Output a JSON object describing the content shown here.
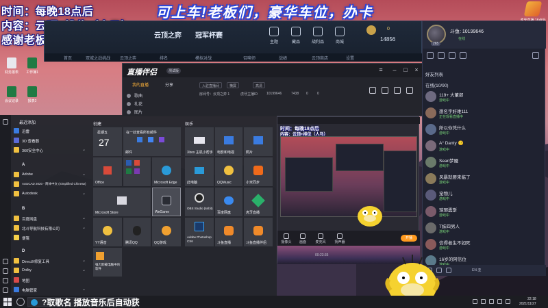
{
  "overlay": {
    "line1": "时间：每晚18点后",
    "line2": "内容：云顶+排位（人马）",
    "line3": "感谢老板们的关注与礼物！",
    "banner": "可上车!老板们，豪华车位，办卡",
    "logo_text": "虎牙直播 18点后"
  },
  "desktop_icons": [
    "回收站",
    "腾讯视频",
    "LOL",
    "WeGame",
    "财务报表",
    "工作簿1",
    "会议记录",
    "报表2"
  ],
  "game": {
    "tab_main": "云顶之弈",
    "tab_cup": "冠军杯赛",
    "nav": [
      "主题",
      "藏品",
      "战利品",
      "商城"
    ],
    "gold": "0",
    "currency": "14856",
    "sub_tabs": [
      "首页",
      "双城之战挑战",
      "云顶之弈",
      "排名",
      "模拟对战",
      "召唤师",
      "战绩",
      "云顶商店",
      "设置"
    ]
  },
  "assistant": {
    "logo": "直播伴侣",
    "badge": "测试版",
    "tabs": [
      "我的直播",
      "分享"
    ],
    "category_label": "热门直播",
    "sources": [
      "歌曲",
      "礼花",
      "图片"
    ],
    "field_title": "入驻直播间",
    "field_mode": "横屏",
    "field_quality": "高清",
    "info": [
      "房间号：云顶之弈 1",
      "虎牙主播ID",
      "10199646",
      "7438",
      "0",
      "0"
    ]
  },
  "preview": {
    "overlay_left": "时间：每晚18点后",
    "overlay_left2": "内容：云顶+排位（人马）",
    "banner_small": "可上车!老板们，豪华车位，办卡",
    "tools": [
      "摄像头",
      "画面",
      "麦克风",
      "扬声器"
    ],
    "go_live": "开播",
    "timestamp": "00:23:35"
  },
  "start_menu": {
    "recent_title": "最近添加",
    "create_title": "创建",
    "browse_title": "娱乐",
    "apps": [
      {
        "label": "迅雷",
        "color": "#3a7be0",
        "expand": false
      },
      {
        "label": "3D 查看器",
        "color": "#5a6ad8",
        "expand": false
      },
      {
        "label": "360安全中心",
        "color": "#f0c040",
        "expand": true
      },
      {
        "label": "Adobe",
        "color": "#f0c040",
        "expand": true
      },
      {
        "label": "AutoCAD 2020 - 简体中文 (Simplified Chinese)",
        "color": "#f0c040",
        "expand": true
      },
      {
        "label": "Autodesk",
        "color": "#f0c040",
        "expand": true
      },
      {
        "label": "百度网盘",
        "color": "#f0c040",
        "expand": true
      },
      {
        "label": "北斗导航科技有限公司",
        "color": "#f0c040",
        "expand": true
      },
      {
        "label": "便笺",
        "color": "#f5d04a",
        "expand": false
      },
      {
        "label": "DirectX修复工具",
        "color": "#f0c040",
        "expand": true
      },
      {
        "label": "Dolby",
        "color": "#f0c040",
        "expand": true
      },
      {
        "label": "地图",
        "color": "#d84a4a",
        "expand": false
      },
      {
        "label": "电脑管家",
        "color": "#3a7be0",
        "expand": true
      }
    ],
    "letters": [
      "A",
      "B",
      "D"
    ],
    "tiles": [
      {
        "label": "星期五",
        "big": "27",
        "color": "#3a3c44"
      },
      {
        "label": "邮件",
        "big": "",
        "color": "#3a3c44"
      },
      {
        "label": "Office",
        "big": "",
        "color": "#3a3c44"
      },
      {
        "label": "Microsoft Edge",
        "big": "",
        "color": "#3a3c44"
      },
      {
        "label": "Microsoft Store",
        "big": "",
        "color": "#3a3c44"
      },
      {
        "label": "WeGame",
        "big": "",
        "color": "#4a4c55"
      },
      {
        "label": "YY语音",
        "big": "",
        "color": "#3a3c44"
      },
      {
        "label": "腾讯QQ",
        "big": "",
        "color": "#3a3c44"
      },
      {
        "label": "QQ游戏",
        "big": "",
        "color": "#3a3c44"
      },
      {
        "label": "强力卸载电脑中的软件",
        "big": "",
        "color": "#3a3c44"
      },
      {
        "label": "Xbox 主机小帮手",
        "big": "",
        "color": "#3a3c44"
      },
      {
        "label": "电影和电视",
        "big": "",
        "color": "#3a3c44"
      },
      {
        "label": "照片",
        "big": "",
        "color": "#3a3c44"
      },
      {
        "label": "此电脑",
        "big": "",
        "color": "#3a3c44"
      },
      {
        "label": "QQMusic",
        "big": "",
        "color": "#3a3c44"
      },
      {
        "label": "小米同步",
        "big": "",
        "color": "#3a3c44"
      },
      {
        "label": "OBS Studio (64bit)",
        "big": "",
        "color": "#3a3c44"
      },
      {
        "label": "百度网盘",
        "big": "",
        "color": "#3a3c44"
      },
      {
        "label": "虎牙直播",
        "big": "",
        "color": "#3a3c44"
      },
      {
        "label": "Adobe Photoshop CS6",
        "big": "",
        "color": "#3a3c44"
      },
      {
        "label": "斗鱼直播",
        "big": "",
        "color": "#3a3c44"
      },
      {
        "label": "斗鱼直播伴侣",
        "big": "",
        "color": "#3a3c44"
      }
    ],
    "tile_strip_label": "在一处查看所有邮件"
  },
  "chat_panel": {
    "name": "斗鱼: 10199646",
    "level": "265",
    "status": "在线",
    "title": "好友列表",
    "section": "在线(10/90)",
    "friends": [
      {
        "name": "119+ 大董郎",
        "status": "游戏中"
      },
      {
        "name": "想名字好难111",
        "status": "正在观看直播中"
      },
      {
        "name": "所以你凭什么",
        "status": "游戏中"
      },
      {
        "name": "A° Danty 🙂",
        "status": "游戏中"
      },
      {
        "name": "Sean梦魇",
        "status": "游戏中"
      },
      {
        "name": "风暴就要来临了",
        "status": "游戏中"
      },
      {
        "name": "宠物儿",
        "status": "游戏中"
      },
      {
        "name": "琅琊蠹斯",
        "status": "游戏中"
      },
      {
        "name": "T妹四男人",
        "status": "游戏中"
      },
      {
        "name": "信得者生不如死",
        "status": "游戏中"
      },
      {
        "name": "16岁的阿信位",
        "status": "游戏中"
      }
    ],
    "bottom_label": "EN.亚"
  },
  "taskbar": {
    "marquee": "?取歌名 播放音乐后自动获",
    "time": "22:18",
    "date": "2021/11/27"
  },
  "colors": {
    "accent": "#ff9a1f",
    "banner_outline": "#2a46d8",
    "status_green": "#7bd77b"
  }
}
